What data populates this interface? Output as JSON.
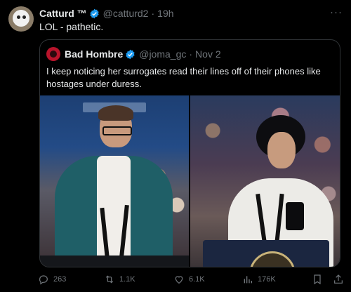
{
  "tweet": {
    "author_name": "Catturd ™",
    "handle": "@catturd2",
    "separator": "·",
    "time": "19h",
    "text": "LOL - pathetic.",
    "more_label": "···"
  },
  "quote": {
    "author_name": "Bad Hombre",
    "handle": "@joma_gc",
    "separator": "·",
    "date": "Nov 2",
    "text": "I keep noticing her surrogates read their lines off of their phones like hostages under duress."
  },
  "actions": {
    "replies": "263",
    "retweets": "1.1K",
    "likes": "6.1K",
    "views": "176K"
  },
  "colors": {
    "background": "#000000",
    "muted": "#71767b",
    "verified": "#1d9bf0",
    "border": "#2f3336"
  },
  "icons": [
    "reply-icon",
    "retweet-icon",
    "like-icon",
    "views-icon",
    "bookmark-icon",
    "share-icon",
    "verified-icon",
    "more-icon"
  ]
}
